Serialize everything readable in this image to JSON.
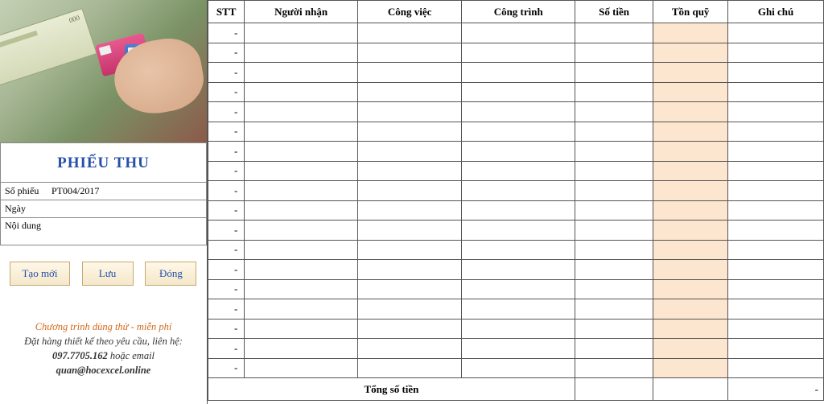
{
  "title": "PHIẾU THU",
  "form": {
    "receipt_no_label": "Số phiếu",
    "receipt_no": "PT004/2017",
    "date_label": "Ngày",
    "date": "",
    "content_label": "Nội dung",
    "content": ""
  },
  "buttons": {
    "new": "Tạo mới",
    "save": "Lưu",
    "close": "Đóng"
  },
  "footer": {
    "line1": "Chương trình dùng thử - miễn phí",
    "line2": "Đặt hàng thiết kế theo yêu cầu, liên hệ:",
    "phone": "097.7705.162",
    "phone_suffix": " hoặc email",
    "email": "quan@hocexcel.online"
  },
  "table": {
    "headers": {
      "stt": "STT",
      "recipient": "Người nhận",
      "job": "Công việc",
      "project": "Công trình",
      "amount": "Số tiền",
      "fund": "Tồn quỹ",
      "note": "Ghi chú"
    },
    "row_marker": "-",
    "row_count": 18,
    "total_label": "Tổng số tiền",
    "total_note": "-"
  }
}
